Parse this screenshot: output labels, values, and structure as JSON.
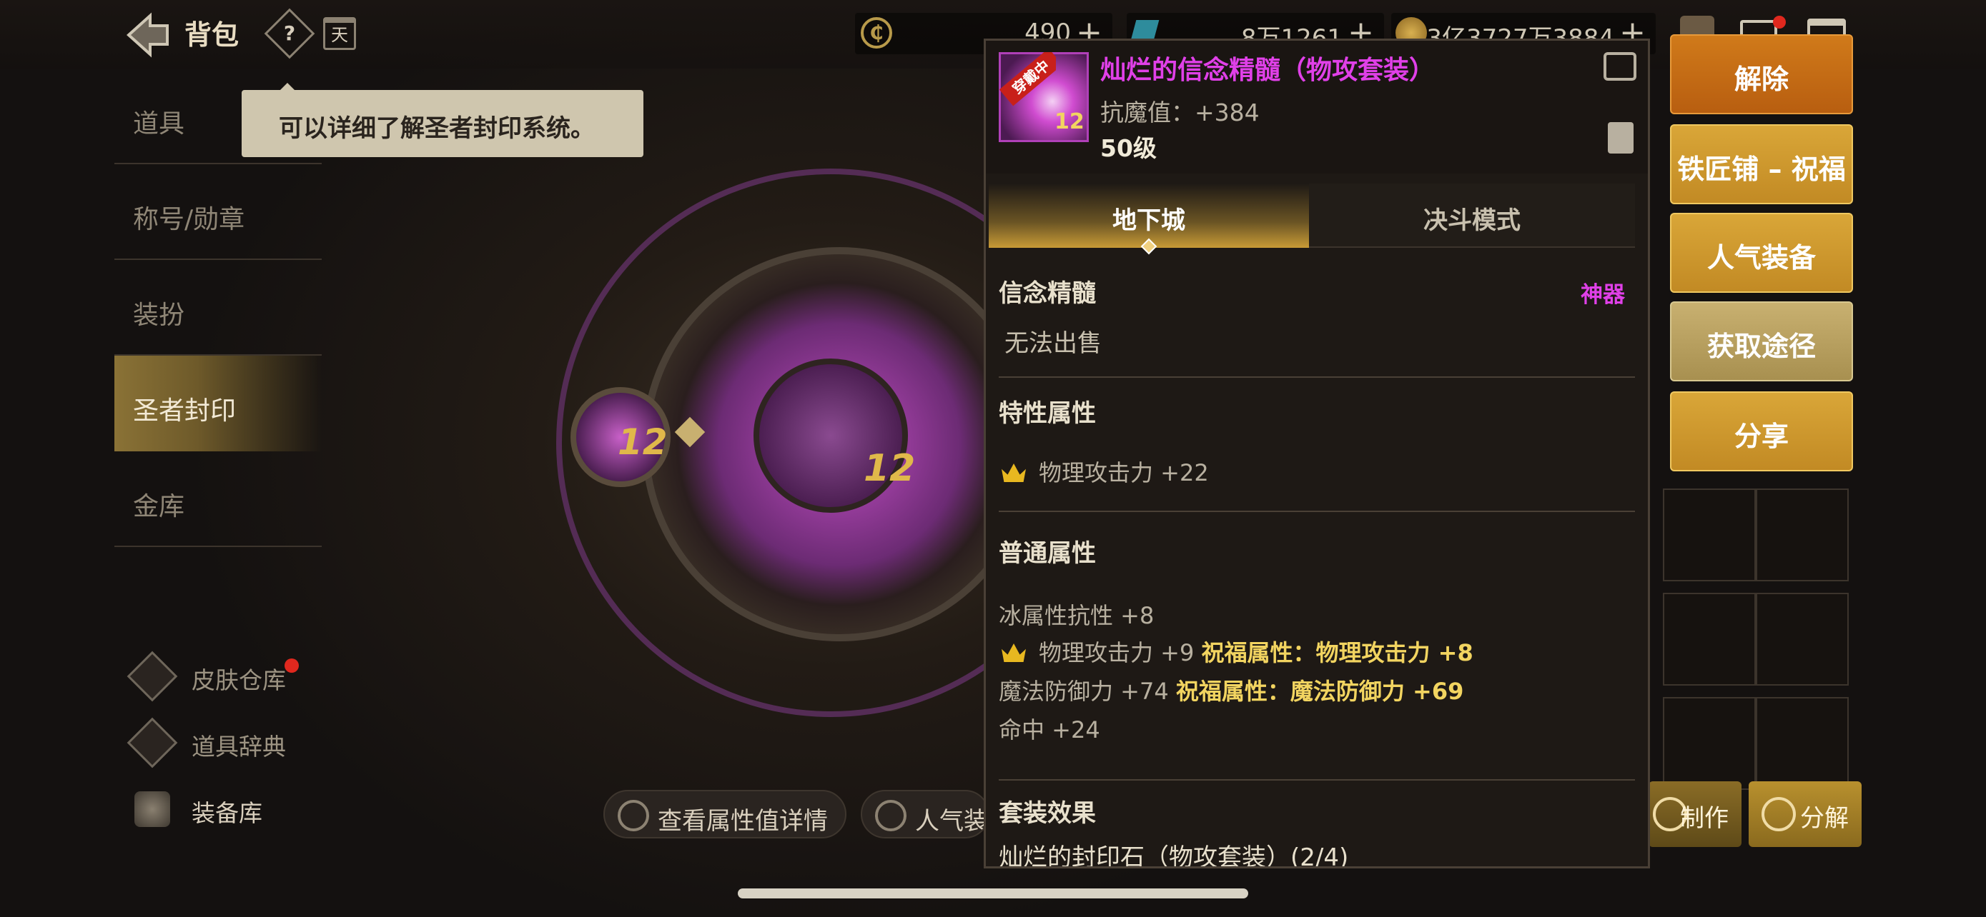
{
  "header": {
    "title": "背包",
    "help_label": "?",
    "calendar_label": "天",
    "currencies": [
      {
        "name": "coin-icon",
        "amount": "490"
      },
      {
        "name": "crystal-icon",
        "amount": "8万1261"
      },
      {
        "name": "gold-icon",
        "amount": "3亿3727万3884"
      }
    ],
    "plus": "+"
  },
  "nav": {
    "items": [
      "道具",
      "称号/勋章",
      "装扮",
      "圣者封印",
      "金库"
    ],
    "active": "圣者封印"
  },
  "side_links": {
    "skin": "皮肤仓库",
    "dict": "道具辞典",
    "equip": "装备库"
  },
  "tooltip": "可以详细了解圣者封印系统。",
  "seal": {
    "core_level": "12",
    "slot_level": "12"
  },
  "bottom_buttons": {
    "attr_detail": "查看属性值详情",
    "popular": "人气装备"
  },
  "right_bottom": {
    "craft": "制作",
    "disassemble": "分解"
  },
  "popup": {
    "badge": "穿戴中",
    "icon_level": "12",
    "name": "灿烂的信念精髓（物攻套装）",
    "stat": "抗魔值：+384",
    "level": "50级",
    "tabs": [
      "地下城",
      "决斗模式"
    ],
    "type": "信念精髓",
    "rarity": "神器",
    "trade": "无法出售",
    "special_title": "特性属性",
    "special_attr": "物理攻击力 +22",
    "common_title": "普通属性",
    "common_attrs": {
      "ice": "冰属性抗性 +8",
      "patk": "物理攻击力 +9",
      "patk_bless": "祝福属性：物理攻击力 +8",
      "mdef": "魔法防御力 +74",
      "mdef_bless": "祝福属性：魔法防御力 +69",
      "hit": "命中 +24"
    },
    "set_title": "套装效果",
    "set_name": "灿烂的封印石（物攻套装）(2/4)"
  },
  "actions": {
    "remove": "解除",
    "smith": "铁匠铺 – 祝福",
    "popular": "人气装备",
    "source": "获取途径",
    "share": "分享"
  },
  "colors": {
    "accent_gold": "#c28a24",
    "epic_purple": "#e040e8",
    "bless_yellow": "#f2d460"
  }
}
